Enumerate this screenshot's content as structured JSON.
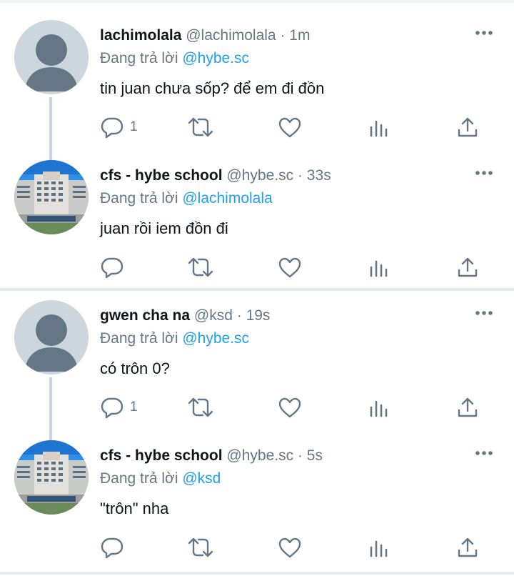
{
  "tweets": [
    {
      "name": "lachimolala",
      "handle": "@lachimolala",
      "separator": "·",
      "time": "1m",
      "reply_prefix": "Đang trả lời",
      "reply_to": "@hybe.sc",
      "text": "tin juan chưa sốp? để em đi đồn",
      "reply_count": "1",
      "avatar": "default-avatar"
    },
    {
      "name": "cfs - hybe school",
      "handle": "@hybe.sc",
      "separator": "·",
      "time": "33s",
      "reply_prefix": "Đang trả lời",
      "reply_to": "@lachimolala",
      "text": "juan rồi iem đồn đi",
      "reply_count": "",
      "avatar": "school-building-photo"
    },
    {
      "name": "gwen cha na",
      "handle": "@ksd",
      "separator": "·",
      "time": "19s",
      "reply_prefix": "Đang trả lời",
      "reply_to": "@hybe.sc",
      "text": "có trôn 0?",
      "reply_count": "1",
      "avatar": "default-avatar"
    },
    {
      "name": "cfs - hybe school",
      "handle": "@hybe.sc",
      "separator": "·",
      "time": "5s",
      "reply_prefix": "Đang trả lời",
      "reply_to": "@ksd",
      "text": "\"trôn\" nha",
      "reply_count": "",
      "avatar": "school-building-photo"
    }
  ],
  "icons": {
    "reply": "reply-icon",
    "retweet": "retweet-icon",
    "like": "heart-icon",
    "analytics": "analytics-icon",
    "share": "share-icon",
    "more": "more-options-icon"
  },
  "colors": {
    "icon": "#657786",
    "mention": "#1da1f2",
    "text": "#0f1419",
    "avatar_default": "#ccd6dd",
    "avatar_silhouette": "#657786",
    "divider": "#e7ebed"
  }
}
